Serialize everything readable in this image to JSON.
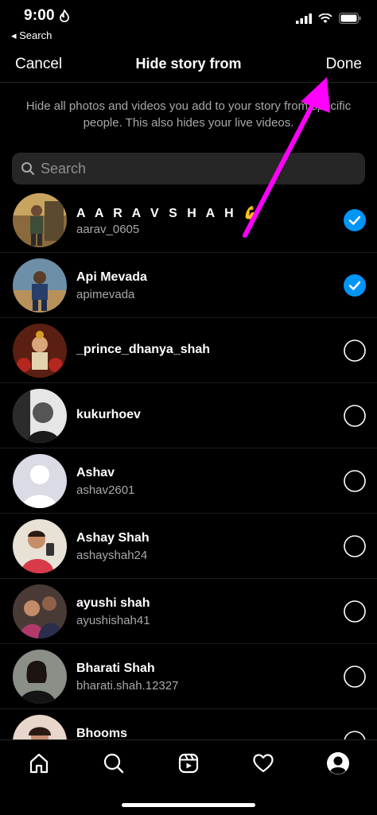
{
  "status": {
    "time": "9:00",
    "back_label": "◂ Search"
  },
  "nav": {
    "cancel": "Cancel",
    "title": "Hide story from",
    "done": "Done"
  },
  "description": "Hide all photos and videos you add to your story from specific people. This also hides your live videos.",
  "search": {
    "placeholder": "Search"
  },
  "accent": "#0095f6",
  "annotation_color": "#ff00ff",
  "users": [
    {
      "name": "A A R A V  S H A H 💪",
      "username": "aarav_0605",
      "selected": true
    },
    {
      "name": "Api Mevada",
      "username": "apimevada",
      "selected": true
    },
    {
      "name": "_prince_dhanya_shah",
      "username": "",
      "selected": false
    },
    {
      "name": "kukurhoev",
      "username": "",
      "selected": false
    },
    {
      "name": "Ashav",
      "username": "ashav2601",
      "selected": false
    },
    {
      "name": "Ashay Shah",
      "username": "ashayshah24",
      "selected": false
    },
    {
      "name": "ayushi shah",
      "username": "ayushishah41",
      "selected": false
    },
    {
      "name": "Bharati Shah",
      "username": "bharati.shah.12327",
      "selected": false
    },
    {
      "name": "Bhooms",
      "username": "",
      "selected": false
    }
  ],
  "tabbar": {
    "items": [
      "home-icon",
      "search-icon",
      "reels-icon",
      "heart-icon",
      "profile-icon"
    ]
  }
}
